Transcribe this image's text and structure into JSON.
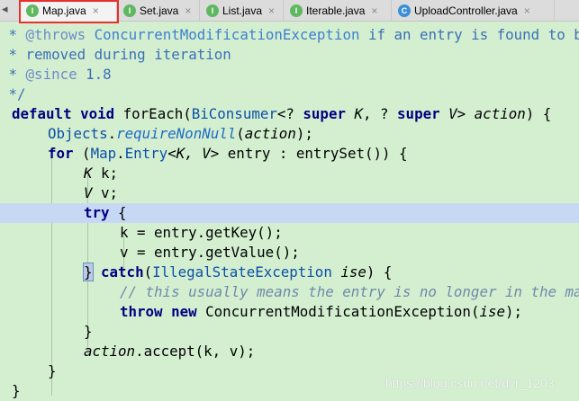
{
  "tabs": [
    {
      "label": "Map.java",
      "icon": "interface-icon",
      "active": true
    },
    {
      "label": "Set.java",
      "icon": "interface-icon"
    },
    {
      "label": "List.java",
      "icon": "interface-icon"
    },
    {
      "label": "Iterable.java",
      "icon": "interface-icon"
    },
    {
      "label": "UploadController.java",
      "icon": "class-icon"
    }
  ],
  "tab_icon_letters": {
    "interface": "I",
    "class": "C"
  },
  "tab_close_glyph": "×",
  "code": {
    "l1": {
      "star": " * ",
      "tag": "@throws",
      "exc": "ConcurrentModificationException",
      "rest": " if an entry is found to be"
    },
    "l2": " * removed during iteration",
    "l3": {
      "star": " * ",
      "tag": "@since",
      "rest": " 1.8"
    },
    "l4": " */",
    "l5": {
      "kw1": "default",
      "kw2": "void",
      "name": " forEach(",
      "type": "BiConsumer",
      "g1": "<? ",
      "sup1": "super",
      "k": " K",
      "c1": ", ? ",
      "sup2": "super",
      "v": " V",
      "g2": "> ",
      "param": "action",
      "end": ") {"
    },
    "l6": {
      "cls": "Objects",
      "dot": ".",
      "m": "requireNonNull",
      "open": "(",
      "param": "action",
      "close": ");"
    },
    "l7": {
      "kw": "for",
      "open": " (",
      "cls": "Map",
      "dot": ".",
      "entry": "Entry",
      "gen": "<K, V>",
      "rest": " entry : entrySet()) {"
    },
    "l8": {
      "t": "K",
      "v": " k;"
    },
    "l9": {
      "t": "V",
      "v": " v;"
    },
    "l10": {
      "kw": "try",
      "brace": " {"
    },
    "l11": "k = entry.getKey();",
    "l12": "v = entry.getValue();",
    "l13": {
      "brace": "}",
      "kw": " catch",
      "open": "(",
      "exc": "IllegalStateException",
      "param": " ise",
      "close": ") {"
    },
    "l14": "// this usually means the entry is no longer in the map.",
    "l15": {
      "kw1": "throw",
      "kw2": " new",
      "rest": " ConcurrentModificationException(",
      "param": "ise",
      "end": ");"
    },
    "l16": "}",
    "l17": {
      "param": "action",
      "rest": ".accept(k, v);"
    },
    "l18": "}",
    "l19": "}"
  },
  "watermark": "https://blog.csdn.net/dyr_1203",
  "colors": {
    "editor_bg": "#d3efd0",
    "highlight": "#c7d8f4",
    "keyword": "#000080",
    "active_tab_border": "#e8302a"
  }
}
